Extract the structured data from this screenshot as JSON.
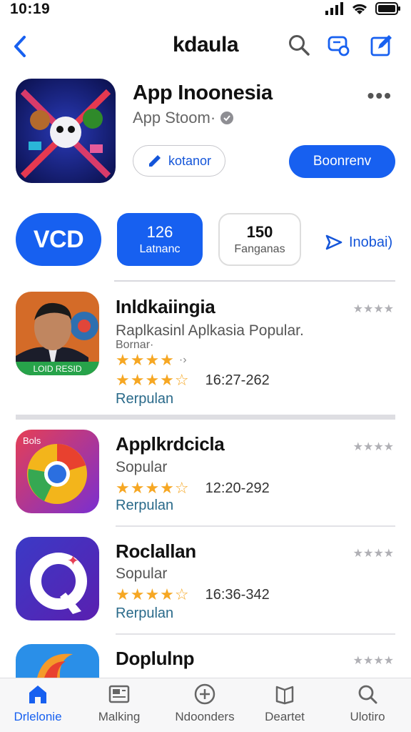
{
  "status_bar": {
    "time": "10:19"
  },
  "nav": {
    "title": "kdaula"
  },
  "hero": {
    "title": "App Inoonesia",
    "subtitle": "App Stoom·",
    "outline_button": "kotanor",
    "primary_button": "Boonrenv"
  },
  "chips": {
    "vcd": "VCD",
    "chip1": {
      "number": "126",
      "label": "Latnanc"
    },
    "chip2": {
      "number": "150",
      "label": "Fanganas"
    },
    "link": "Inobai)"
  },
  "apps": [
    {
      "name": "Inldkaiingia",
      "subtitle": "Raplkasinl Aplkasia Popular.",
      "subtitle2": "Bornar·",
      "rating_text": "16:27-262",
      "category": "Rerpulan",
      "icon_text": "LOID RESID",
      "stars": "★★★★☆",
      "mini_stars": "★★★★"
    },
    {
      "name": "Applkrdcicla",
      "subtitle": "Sopular",
      "rating_text": "12:20-292",
      "category": "Rerpulan",
      "icon_text": "Bols",
      "stars": "★★★★☆",
      "mini_stars": "★★★★"
    },
    {
      "name": "Roclallan",
      "subtitle": "Sopular",
      "rating_text": "16:36-342",
      "category": "Rerpulan",
      "stars": "★★★★☆",
      "mini_stars": "★★★★"
    },
    {
      "name": "Doplulnp",
      "mini_stars": "★★★★"
    }
  ],
  "tabs": [
    {
      "label": "Drlelonie",
      "active": true
    },
    {
      "label": "Malking"
    },
    {
      "label": "Ndoonders"
    },
    {
      "label": "Deartet"
    },
    {
      "label": "Ulotiro"
    }
  ],
  "colors": {
    "accent": "#1760f0",
    "star": "#f6a723"
  }
}
